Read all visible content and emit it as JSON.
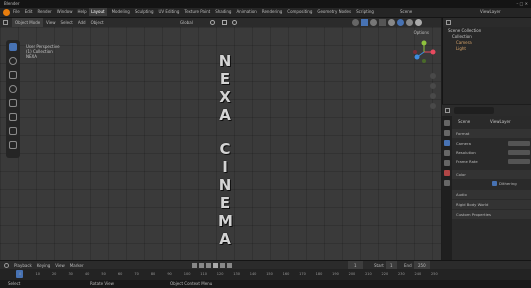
{
  "window": {
    "title": "Blender"
  },
  "menu": {
    "items": [
      "File",
      "Edit",
      "Render",
      "Window",
      "Help"
    ],
    "workspaces": [
      "Layout",
      "Modeling",
      "Sculpting",
      "UV Editing",
      "Texture Paint",
      "Shading",
      "Animation",
      "Rendering",
      "Compositing",
      "Geometry Nodes",
      "Scripting"
    ],
    "scene_label": "Scene",
    "view_layer_label": "ViewLayer"
  },
  "viewport_header": {
    "mode": "Object Mode",
    "menus": [
      "View",
      "Select",
      "Add",
      "Object"
    ],
    "orientation": "Global"
  },
  "viewport_overlay": {
    "view_name": "User Perspective",
    "collection": "(1) Collection",
    "object": "NEXA",
    "options_label": "Options"
  },
  "title_letters": [
    "N",
    "E",
    "X",
    "A",
    "C",
    "I",
    "N",
    "E",
    "M",
    "A"
  ],
  "outliner": {
    "header": "Scene Collection",
    "items": [
      {
        "label": "Collection"
      },
      {
        "label": "Camera"
      },
      {
        "label": "Light"
      }
    ]
  },
  "properties": {
    "search_placeholder": "",
    "breadcrumb": [
      "Scene",
      "ViewLayer"
    ],
    "sections": [
      {
        "label": "Format"
      },
      {
        "label": "Camera"
      },
      {
        "label": "Resolution"
      },
      {
        "label": "Frame Rate"
      },
      {
        "label": "Color"
      },
      {
        "label": "Dithering"
      },
      {
        "label": "Audio"
      },
      {
        "label": "Rigid Body World"
      },
      {
        "label": "Custom Properties"
      }
    ]
  },
  "timeline": {
    "menus": [
      "Playback",
      "Keying",
      "View",
      "Marker"
    ],
    "start_label": "Start",
    "start": "1",
    "end_label": "End",
    "end": "250",
    "current_frame": "1",
    "ticks": [
      "0",
      "10",
      "20",
      "30",
      "40",
      "50",
      "60",
      "70",
      "80",
      "90",
      "100",
      "110",
      "120",
      "130",
      "140",
      "150",
      "160",
      "170",
      "180",
      "190",
      "200",
      "210",
      "220",
      "230",
      "240",
      "250"
    ]
  },
  "status": {
    "left": "Select",
    "mid": "Rotate View",
    "right": "Object Context Menu"
  },
  "colors": {
    "accent": "#4772b3",
    "gizmo_x": "#e84a5f",
    "gizmo_y": "#8fc33e",
    "gizmo_z": "#3f8de0",
    "active_frame": "#4772b3"
  }
}
